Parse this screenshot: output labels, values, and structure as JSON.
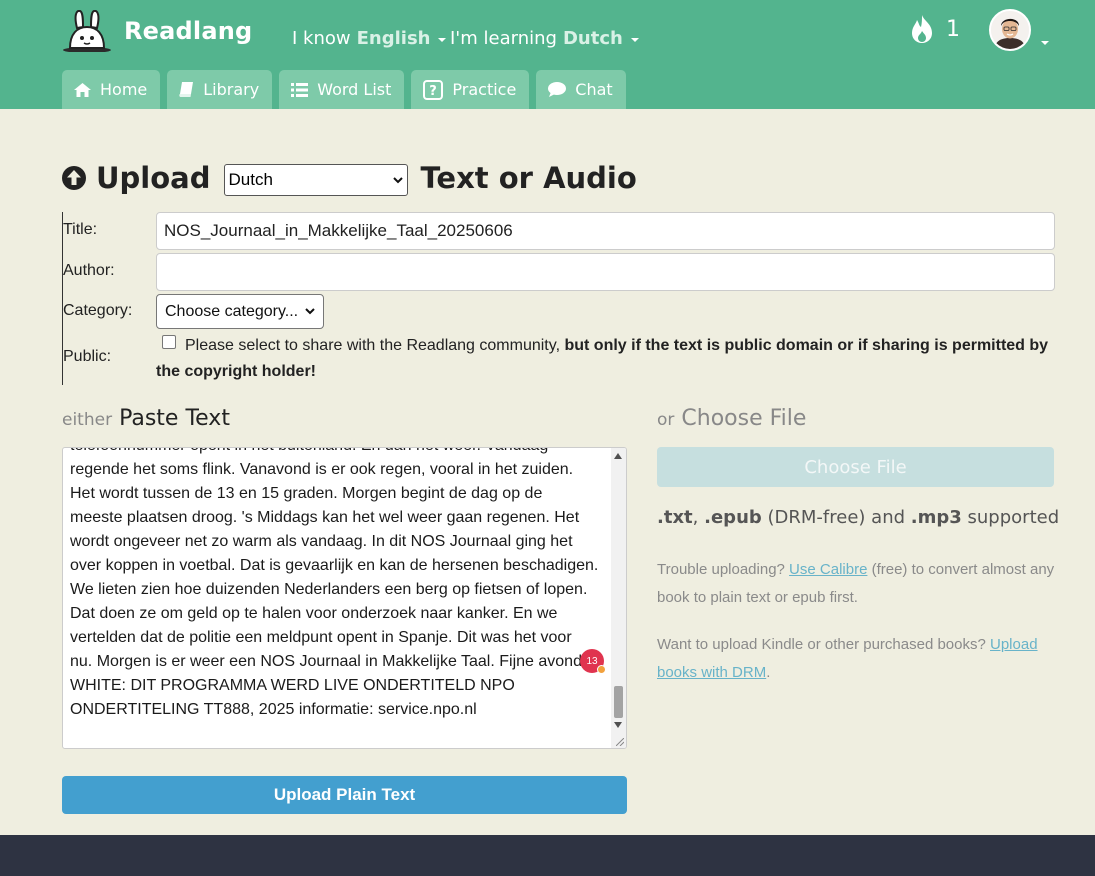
{
  "app": {
    "name": "Readlang"
  },
  "header": {
    "know_prefix": "I know",
    "know_lang": "English",
    "learning_prefix": "I'm learning",
    "learning_lang": "Dutch",
    "streak_count": "1"
  },
  "tabs": [
    {
      "label": "Home",
      "icon": "home-icon"
    },
    {
      "label": "Library",
      "icon": "book-icon"
    },
    {
      "label": "Word List",
      "icon": "list-icon"
    },
    {
      "label": "Practice",
      "icon": "question-icon"
    },
    {
      "label": "Chat",
      "icon": "chat-icon"
    }
  ],
  "upload": {
    "title_left": "Upload",
    "title_right": "Text or Audio",
    "language_selected": "Dutch"
  },
  "form": {
    "title_label": "Title:",
    "title_value": "NOS_Journaal_in_Makkelijke_Taal_20250606",
    "author_label": "Author:",
    "author_value": "",
    "category_label": "Category:",
    "category_selected": "Choose category...",
    "public_label": "Public:",
    "public_text": "Please select to share with the Readlang community,",
    "public_bold": "but only if the text is public domain or if sharing is permitted by the copyright holder!"
  },
  "paste": {
    "either": "either",
    "heading": "Paste Text",
    "lines": [
      "telefoonnummer opent in het buitenland. En dan het weer. Vandaag",
      "regende het soms flink. Vanavond is er ook regen, vooral in het zuiden.",
      "Het wordt tussen de 13 en 15 graden. Morgen begint de dag op de",
      "meeste plaatsen droog. 's Middags kan het wel weer gaan regenen. Het",
      "wordt ongeveer net zo warm als vandaag. In dit NOS Journaal ging het",
      "over koppen in voetbal. Dat is gevaarlijk en kan de hersenen beschadigen.",
      "We lieten zien hoe duizenden Nederlanders een berg op fietsen of lopen.",
      "Dat doen ze om geld op te halen voor onderzoek naar kanker. En we",
      "vertelden dat de politie een meldpunt opent in Spanje. Dit was het voor",
      "nu. Morgen is er weer een NOS Journaal in Makkelijke Taal. Fijne avond!",
      "WHITE: DIT PROGRAMMA WERD LIVE ONDERTITELD NPO",
      "ONDERTITELING TT888, 2025 informatie: service.npo.nl"
    ],
    "badge_count": "13",
    "upload_button": "Upload Plain Text"
  },
  "file": {
    "or": "or",
    "heading": "Choose File",
    "button": "Choose File",
    "formats": {
      "txt": ".txt",
      "comma": ",",
      "epub": ".epub",
      "drm_free": "(DRM-free) and",
      "mp3": ".mp3",
      "supported": "supported"
    },
    "trouble_prefix": "Trouble uploading?",
    "calibre_link": "Use Calibre",
    "trouble_suffix": "(free) to convert almost any book to plain text or epub first.",
    "kindle_prefix": "Want to upload Kindle or other purchased books?",
    "drm_link": "Upload books with DRM",
    "kindle_suffix": "."
  },
  "colors": {
    "header": "#53b48e",
    "tab": "#7ecaa9",
    "page_bg": "#efeee0",
    "primary_button": "#439fcf",
    "disabled_button": "#c6dfdf",
    "footer": "#2e3342",
    "badge": "#e0344f"
  }
}
